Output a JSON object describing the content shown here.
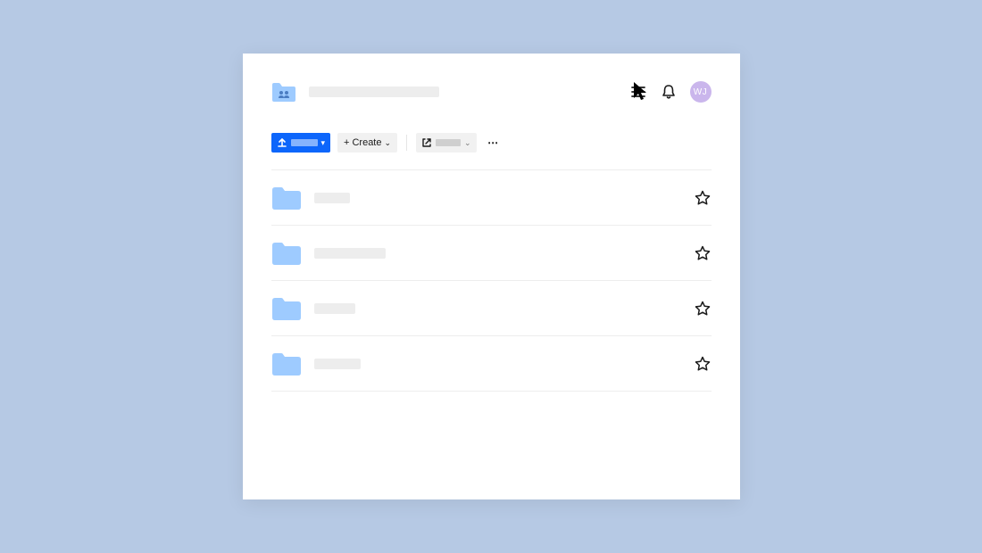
{
  "header": {
    "title_placeholder_width": 146,
    "avatar_initials": "WJ",
    "avatar_color": "#cab6ec",
    "icons": {
      "menu": "menu-icon",
      "notifications": "bell-icon"
    }
  },
  "toolbar": {
    "upload": {
      "label_placeholder": true
    },
    "create": {
      "label": "Create"
    },
    "share": {
      "label_placeholder": true
    },
    "more": {
      "glyph": "⋯"
    }
  },
  "colors": {
    "primary": "#0d66fb",
    "folder": "#9ecbff",
    "bg": "#b6c9e4",
    "avatar": "#cab6ec"
  },
  "items": [
    {
      "name_placeholder_width": 40,
      "starred": false
    },
    {
      "name_placeholder_width": 80,
      "starred": false
    },
    {
      "name_placeholder_width": 46,
      "starred": false
    },
    {
      "name_placeholder_width": 52,
      "starred": false
    }
  ]
}
